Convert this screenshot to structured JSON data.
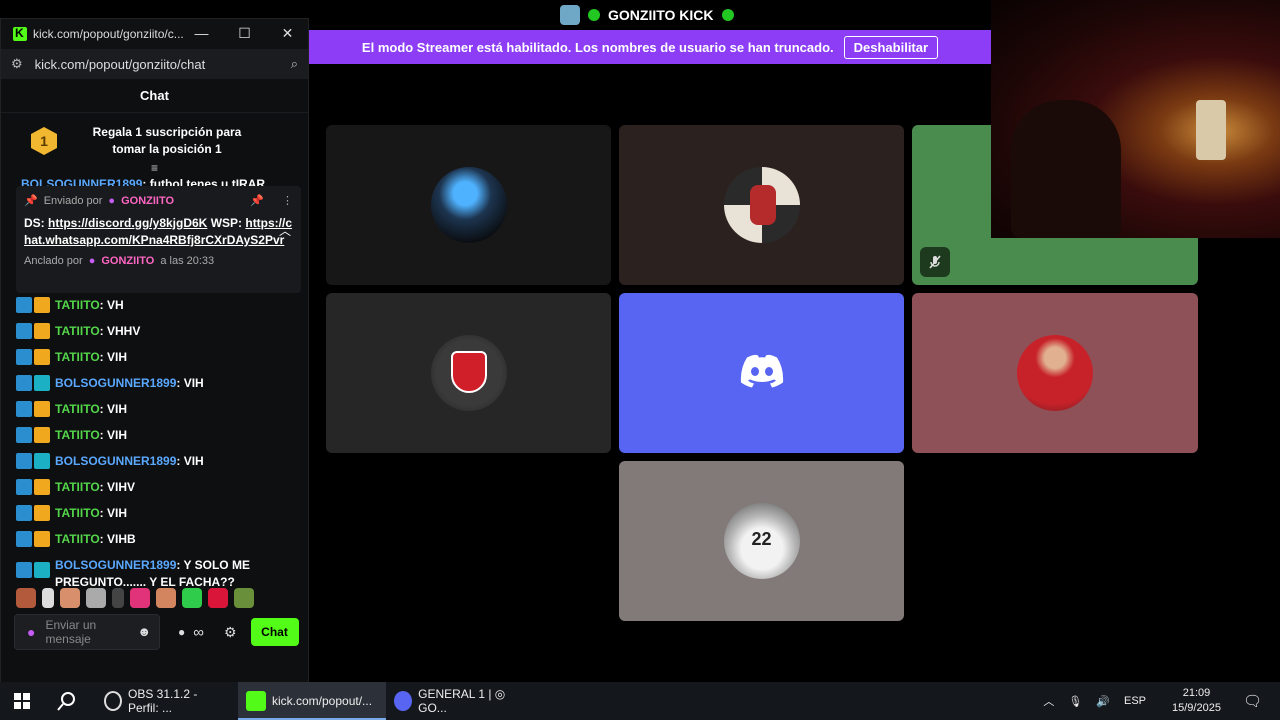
{
  "stage": {
    "title": "GONZIITO KICK",
    "streamer_notice": "El modo Streamer está habilitado. Los nombres de usuario se han truncado.",
    "disable_label": "Deshabilitar"
  },
  "browser": {
    "tab_title": "kick.com/popout/gonziito/c...",
    "url": "kick.com/popout/gonziito/chat"
  },
  "chat": {
    "header": "Chat",
    "sub_banner_rank": "1",
    "sub_banner_text": "Regala 1 suscripción para tomar la posición 1",
    "partial_line_user": "BOLSOGUNNER1899",
    "partial_line_text": ": futbol tenes u tIRAR",
    "pinned": {
      "sent_by_label": "Enviado por",
      "sent_by_user": "GONZIITO",
      "body_prefix_ds": "DS: ",
      "discord_link": "https://discord.gg/y8kjgD6K",
      "body_prefix_wsp": " WSP: ",
      "whatsapp_link": "https://chat.whatsapp.com/KPna4RBfj8rCXrDAyS2Pvr",
      "pinned_by_label": "Anclado por",
      "pinned_by_user": "GONZIITO",
      "pinned_time": "a las 20:33"
    },
    "messages": [
      {
        "user": "TATIITO",
        "text": ": VH",
        "kind": "tat"
      },
      {
        "user": "TATIITO",
        "text": ": VHHV",
        "kind": "tat"
      },
      {
        "user": "TATIITO",
        "text": ": VIH",
        "kind": "tat"
      },
      {
        "user": "BOLSOGUNNER1899",
        "text": ": VIH",
        "kind": "bol"
      },
      {
        "user": "TATIITO",
        "text": ": VIH",
        "kind": "tat"
      },
      {
        "user": "TATIITO",
        "text": ": VIH",
        "kind": "tat"
      },
      {
        "user": "BOLSOGUNNER1899",
        "text": ": VIH",
        "kind": "bol"
      },
      {
        "user": "TATIITO",
        "text": ": VIHV",
        "kind": "tat"
      },
      {
        "user": "TATIITO",
        "text": ": VIH",
        "kind": "tat"
      },
      {
        "user": "TATIITO",
        "text": ": VIHB",
        "kind": "tat"
      },
      {
        "user": "BOLSOGUNNER1899",
        "text": ": Y SOLO ME PREGUNTO....... Y EL FACHA??",
        "kind": "bol"
      }
    ],
    "input_placeholder": "Enviar un mensaje",
    "send_label": "Chat",
    "infinity_label": "∞"
  },
  "taskbar": {
    "items": [
      {
        "label": "OBS 31.1.2 - Perfil: ..."
      },
      {
        "label": "kick.com/popout/..."
      },
      {
        "label": "GENERAL 1 | ◎ GO..."
      }
    ],
    "language": "ESP",
    "time": "21:09",
    "date": "15/9/2025"
  },
  "colors": {
    "kick_green": "#53fc18",
    "streamer_purple": "#8c3df5",
    "discord_blurple": "#5865f2"
  }
}
